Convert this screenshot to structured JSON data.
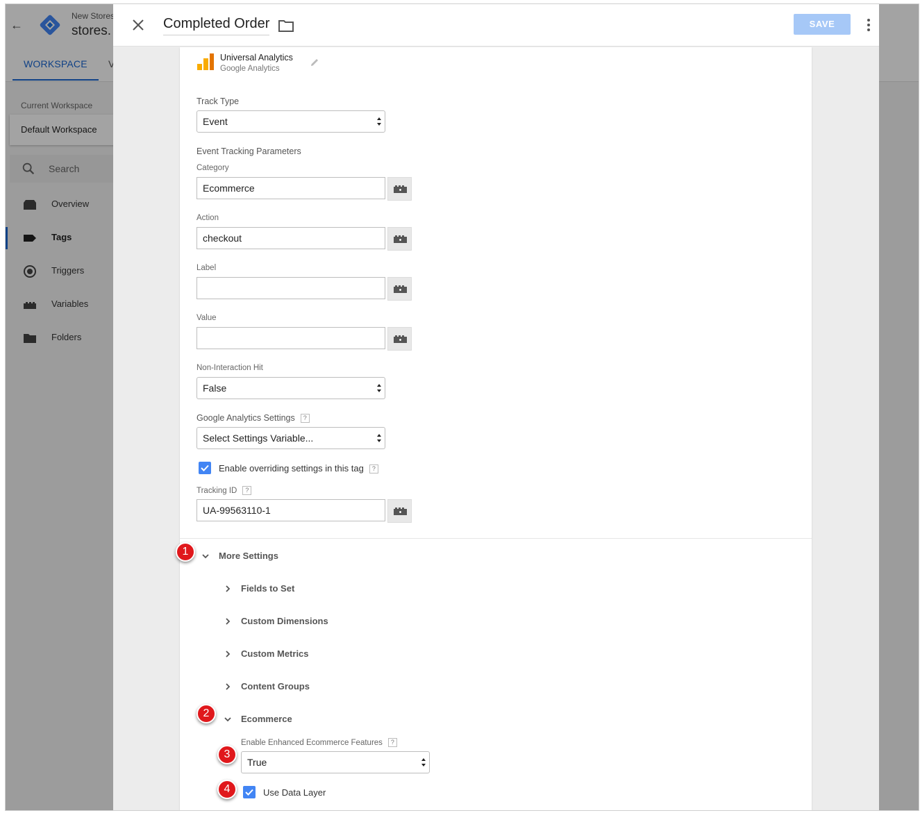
{
  "app": {
    "account_name": "New Stores",
    "container_name": "stores.",
    "tabs": {
      "workspace": "WORKSPACE",
      "versions_partial": "V"
    },
    "current_workspace_label": "Current Workspace",
    "workspace_name": "Default Workspace",
    "search_placeholder": "Search",
    "nav": [
      {
        "label": "Overview",
        "icon": "overview-icon"
      },
      {
        "label": "Tags",
        "icon": "tag-icon",
        "active": true
      },
      {
        "label": "Triggers",
        "icon": "trigger-icon"
      },
      {
        "label": "Variables",
        "icon": "variables-icon"
      },
      {
        "label": "Folders",
        "icon": "folder-icon"
      }
    ]
  },
  "panel": {
    "title": "Completed Order",
    "save_label": "SAVE",
    "tag_type": {
      "name": "Universal Analytics",
      "vendor": "Google Analytics"
    },
    "track_type": {
      "label": "Track Type",
      "value": "Event"
    },
    "event_params_heading": "Event Tracking Parameters",
    "fields": {
      "category": {
        "label": "Category",
        "value": "Ecommerce"
      },
      "action": {
        "label": "Action",
        "value": "checkout"
      },
      "label": {
        "label": "Label",
        "value": ""
      },
      "value": {
        "label": "Value",
        "value": ""
      }
    },
    "non_interaction": {
      "label": "Non-Interaction Hit",
      "value": "False"
    },
    "ga_settings": {
      "label": "Google Analytics Settings",
      "value": "Select Settings Variable...",
      "help": "?"
    },
    "override": {
      "label": "Enable overriding settings in this tag",
      "checked": true,
      "help": "?"
    },
    "tracking_id": {
      "label": "Tracking ID",
      "value": "UA-99563110-1",
      "help": "?"
    },
    "more_settings": {
      "label": "More Settings",
      "sections": [
        "Fields to Set",
        "Custom Dimensions",
        "Custom Metrics",
        "Content Groups",
        "Ecommerce"
      ],
      "ecommerce": {
        "enhanced_label": "Enable Enhanced Ecommerce Features",
        "enhanced_value": "True",
        "help": "?",
        "use_data_layer": "Use Data Layer",
        "use_data_layer_checked": true
      }
    }
  },
  "annotations": [
    "1",
    "2",
    "3",
    "4"
  ],
  "colors": {
    "accent": "#1967d2",
    "save_disabled": "#a6c8f7",
    "checkbox": "#4285f4",
    "badge": "#e0181c"
  }
}
